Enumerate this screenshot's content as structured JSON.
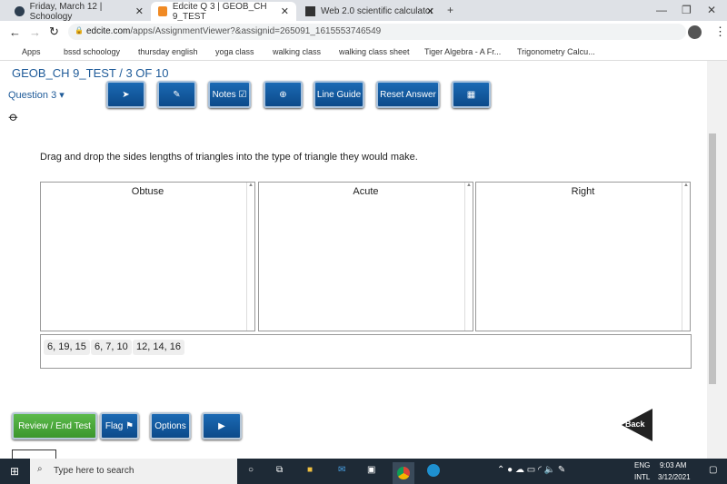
{
  "browser": {
    "tabs": [
      {
        "label": "Friday, March 12 | Schoology",
        "color": "#2d3e50"
      },
      {
        "label": "Edcite Q 3 | GEOB_CH 9_TEST",
        "color": "#f08a24"
      },
      {
        "label": "Web 2.0 scientific calculator",
        "color": "#333333"
      }
    ],
    "url_domain": "edcite.com",
    "url_path": "/apps/AssignmentViewer?&assignid=265091_1615553746549",
    "bookmarks": [
      "Apps",
      "bssd schoology",
      "thursday english",
      "yoga class",
      "walking class",
      "walking class sheet",
      "Tiger Algebra - A Fr...",
      "Trigonometry Calcu..."
    ]
  },
  "page": {
    "title": "GEOB_CH 9_TEST / 3 OF 10",
    "question_select": "Question 3 ▾",
    "toolbar": {
      "pointer": "➤",
      "pencil": "✎",
      "notes": "Notes ☑",
      "zoom": "⊕",
      "line_guide": "Line Guide",
      "reset": "Reset Answer",
      "calculator": "▦"
    },
    "prompt": "Drag and drop the sides lengths of triangles into the type of triangle they would make.",
    "bins": [
      "Obtuse",
      "Acute",
      "Right"
    ],
    "choices": [
      "6, 19, 15",
      "6, 7, 10",
      "12, 14, 16"
    ],
    "footer": {
      "review": "Review / End Test",
      "flag": "Flag ⚑",
      "options": "Options",
      "next": "▶",
      "back": "Back"
    }
  },
  "taskbar": {
    "search_placeholder": "Type here to search",
    "lang": "ENG",
    "lang2": "INTL",
    "time": "9:03 AM",
    "date": "3/12/2021"
  }
}
